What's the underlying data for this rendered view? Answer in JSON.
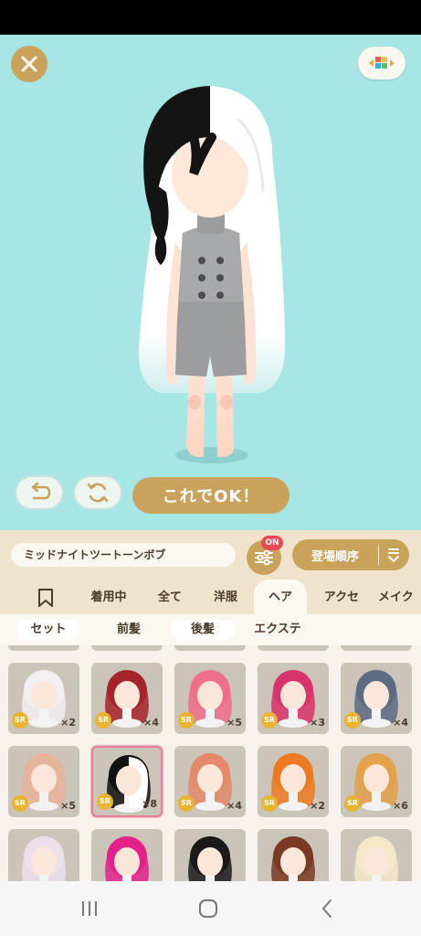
{
  "header": {
    "close_icon": "close-icon",
    "palette_icon": "color-palette-icon"
  },
  "actions": {
    "undo_icon": "undo-arrow-icon",
    "rotate_icon": "rotate-icon",
    "ok_label": "これでOK！"
  },
  "info": {
    "item_name": "ミッドナイトツートーンボブ",
    "filter_badge": "ON",
    "sort_label": "登場順序"
  },
  "category_tabs": [
    {
      "label": "着用中"
    },
    {
      "label": "全て"
    },
    {
      "label": "洋服"
    },
    {
      "label": "ヘア",
      "active": true
    },
    {
      "label": "アクセ"
    },
    {
      "label": "メイク"
    }
  ],
  "sub_tabs": [
    {
      "label": "セット"
    },
    {
      "label": "前髪"
    },
    {
      "label": "後髪"
    },
    {
      "label": "エクステ"
    }
  ],
  "items": [
    {
      "rarity": "SR",
      "count": "×2",
      "hair": "#f2eff0"
    },
    {
      "rarity": "SR",
      "count": "×4",
      "hair": "#a5232a"
    },
    {
      "rarity": "SR",
      "count": "×5",
      "hair": "#ef6f8a"
    },
    {
      "rarity": "SR",
      "count": "×3",
      "hair": "#d9336b"
    },
    {
      "rarity": "SR",
      "count": "×4",
      "hair": "#5c6a82"
    },
    {
      "rarity": "SR",
      "count": "×5",
      "hair": "#e6b49a"
    },
    {
      "rarity": "SR",
      "count": "×8",
      "hair": "#111111",
      "selected": true
    },
    {
      "rarity": "SR",
      "count": "×4",
      "hair": "#e48a6a"
    },
    {
      "rarity": "SR",
      "count": "×2",
      "hair": "#ee7a1f"
    },
    {
      "rarity": "SR",
      "count": "×6",
      "hair": "#e2a14a"
    },
    {
      "rarity": "",
      "count": "",
      "hair": "#ece1ea"
    },
    {
      "rarity": "",
      "count": "",
      "hair": "#e2228a"
    },
    {
      "rarity": "",
      "count": "",
      "hair": "#1a1a1a"
    },
    {
      "rarity": "",
      "count": "",
      "hair": "#7a3a22"
    },
    {
      "rarity": "",
      "count": "",
      "hair": "#f4e8c8"
    }
  ],
  "colors": {
    "stage_bg": "#a6e6e5",
    "gold": "#c9a35b",
    "panel": "#efe3cc",
    "selected_border": "#e58098",
    "badge_red": "#e84a52"
  },
  "navbar": {
    "recent_icon": "recent-apps-icon",
    "home_icon": "home-icon",
    "back_icon": "back-icon"
  }
}
